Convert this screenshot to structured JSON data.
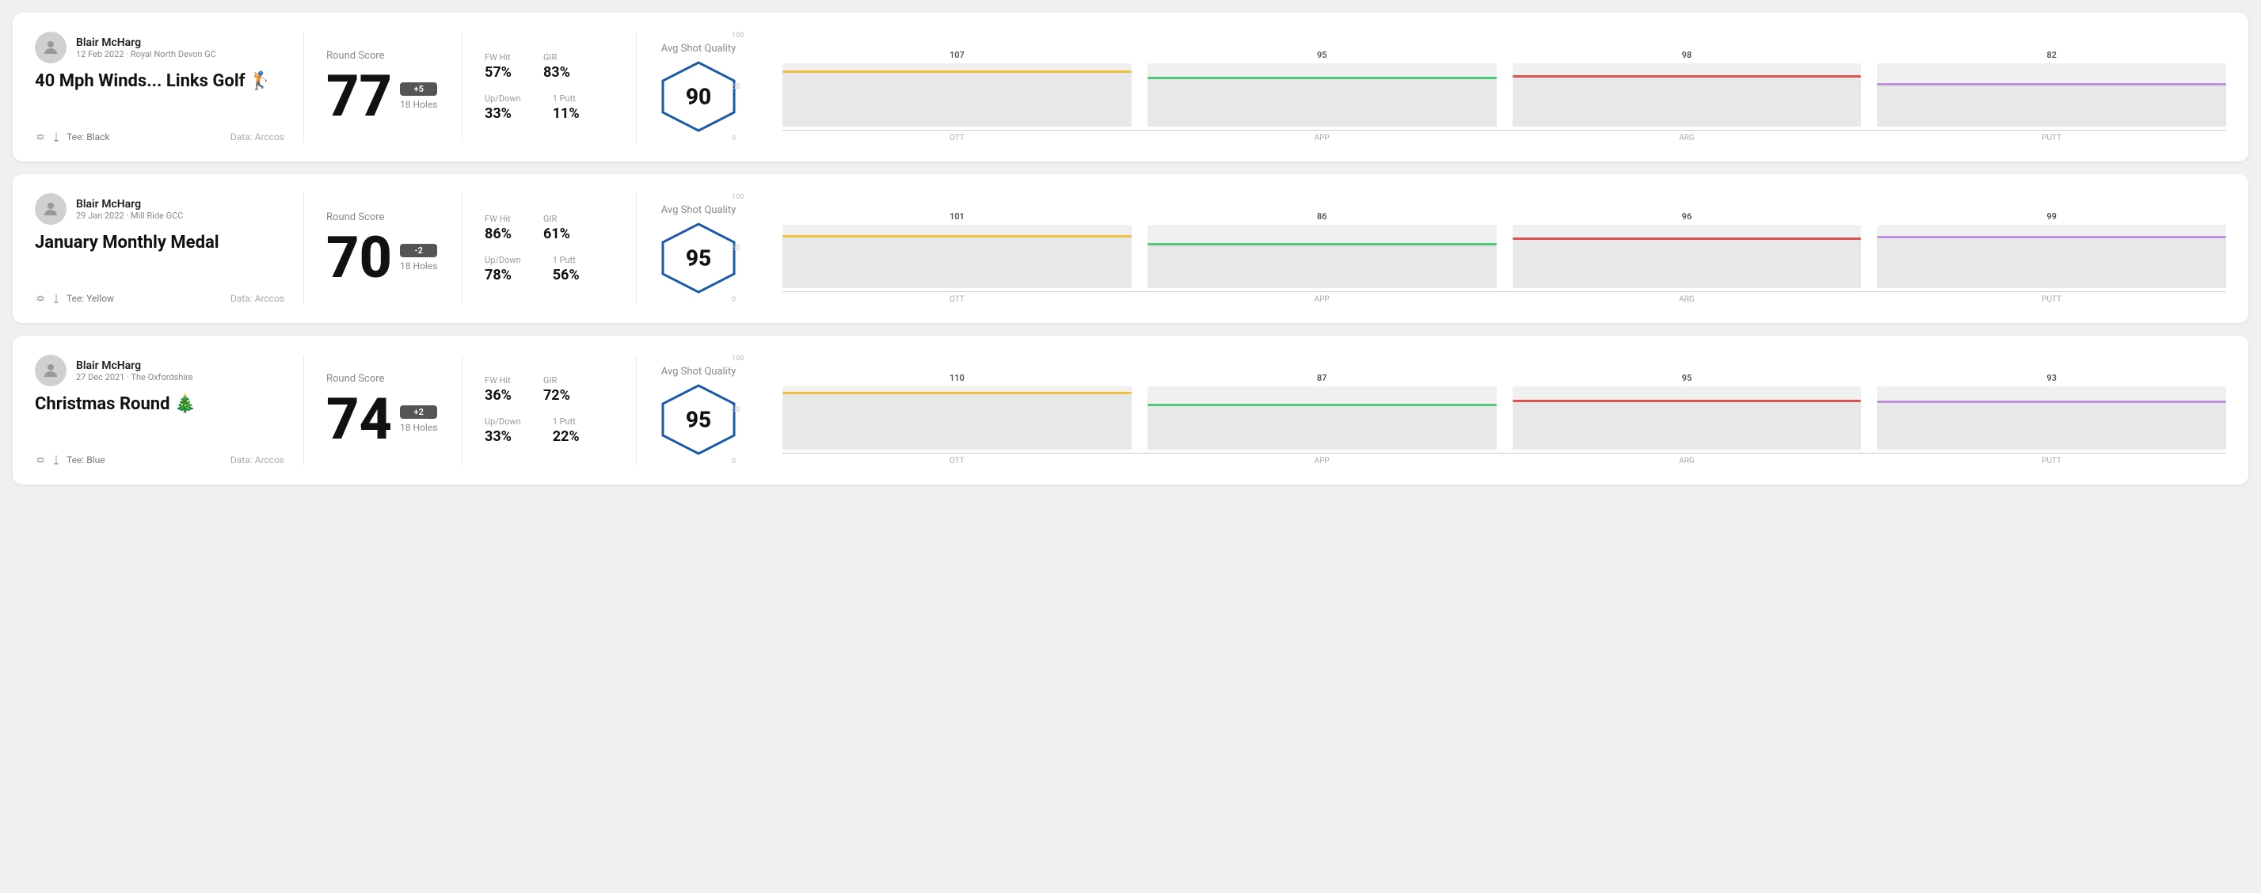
{
  "rounds": [
    {
      "id": "round-1",
      "player_name": "Blair McHarg",
      "player_meta": "12 Feb 2022 · Royal North Devon GC",
      "round_title": "40 Mph Winds... Links Golf 🏌",
      "tee": "Black",
      "data_source": "Data: Arccos",
      "score": "77",
      "score_badge": "+5",
      "holes": "18 Holes",
      "fw_hit": "57%",
      "gir": "83%",
      "up_down": "33%",
      "one_putt": "11%",
      "avg_shot_quality": "90",
      "bars": [
        {
          "label": "OTT",
          "value": 107,
          "color": "#f0c040",
          "max": 120
        },
        {
          "label": "APP",
          "value": 95,
          "color": "#50c878",
          "max": 120
        },
        {
          "label": "ARG",
          "value": 98,
          "color": "#e05050",
          "max": 120
        },
        {
          "label": "PUTT",
          "value": 82,
          "color": "#c090e0",
          "max": 120
        }
      ]
    },
    {
      "id": "round-2",
      "player_name": "Blair McHarg",
      "player_meta": "29 Jan 2022 · Mill Ride GCC",
      "round_title": "January Monthly Medal",
      "tee": "Yellow",
      "data_source": "Data: Arccos",
      "score": "70",
      "score_badge": "-2",
      "holes": "18 Holes",
      "fw_hit": "86%",
      "gir": "61%",
      "up_down": "78%",
      "one_putt": "56%",
      "avg_shot_quality": "95",
      "bars": [
        {
          "label": "OTT",
          "value": 101,
          "color": "#f0c040",
          "max": 120
        },
        {
          "label": "APP",
          "value": 86,
          "color": "#50c878",
          "max": 120
        },
        {
          "label": "ARG",
          "value": 96,
          "color": "#e05050",
          "max": 120
        },
        {
          "label": "PUTT",
          "value": 99,
          "color": "#c090e0",
          "max": 120
        }
      ]
    },
    {
      "id": "round-3",
      "player_name": "Blair McHarg",
      "player_meta": "27 Dec 2021 · The Oxfordshire",
      "round_title": "Christmas Round 🎄",
      "tee": "Blue",
      "data_source": "Data: Arccos",
      "score": "74",
      "score_badge": "+2",
      "holes": "18 Holes",
      "fw_hit": "36%",
      "gir": "72%",
      "up_down": "33%",
      "one_putt": "22%",
      "avg_shot_quality": "95",
      "bars": [
        {
          "label": "OTT",
          "value": 110,
          "color": "#f0c040",
          "max": 120
        },
        {
          "label": "APP",
          "value": 87,
          "color": "#50c878",
          "max": 120
        },
        {
          "label": "ARG",
          "value": 95,
          "color": "#e05050",
          "max": 120
        },
        {
          "label": "PUTT",
          "value": 93,
          "color": "#c090e0",
          "max": 120
        }
      ]
    }
  ],
  "labels": {
    "round_score": "Round Score",
    "fw_hit": "FW Hit",
    "gir": "GIR",
    "up_down": "Up/Down",
    "one_putt": "1 Putt",
    "avg_shot_quality": "Avg Shot Quality",
    "data_arccos": "Data: Arccos",
    "tee_label": "Tee:",
    "y_100": "100",
    "y_50": "50",
    "y_0": "0"
  }
}
